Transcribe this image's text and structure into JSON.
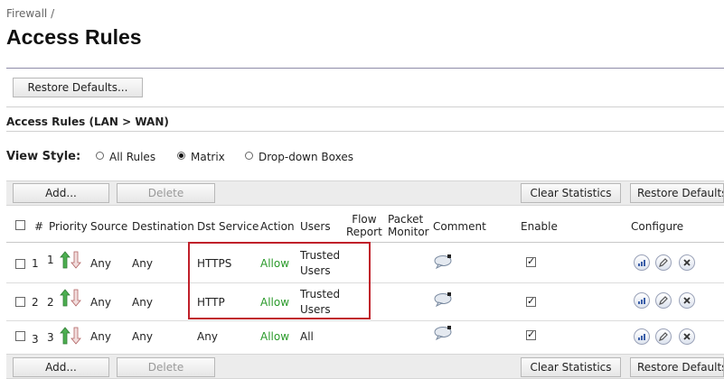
{
  "breadcrumb": "Firewall /",
  "page_title": "Access Rules",
  "restore_defaults_top": "Restore Defaults...",
  "section_title": "Access Rules (LAN > WAN)",
  "view_style": {
    "label": "View Style:",
    "options": [
      {
        "label": "All Rules",
        "selected": false
      },
      {
        "label": "Matrix",
        "selected": true
      },
      {
        "label": "Drop-down Boxes",
        "selected": false
      }
    ]
  },
  "toolbar": {
    "add": "Add...",
    "delete": "Delete",
    "clear_statistics": "Clear Statistics",
    "restore_defaults": "Restore Defaults..."
  },
  "columns": {
    "num": "#",
    "priority": "Priority",
    "source": "Source",
    "destination": "Destination",
    "dst_service": "Dst Service",
    "action": "Action",
    "users": "Users",
    "flow_report_1": "Flow",
    "flow_report_2": "Report",
    "packet_monitor_1": "Packet",
    "packet_monitor_2": "Monitor",
    "comment": "Comment",
    "enable": "Enable",
    "configure": "Configure"
  },
  "rows": [
    {
      "num": "1",
      "priority": "1",
      "source": "Any",
      "destination": "Any",
      "service": "HTTPS",
      "action": "Allow",
      "users_1": "Trusted",
      "users_2": "Users",
      "enabled": true
    },
    {
      "num": "2",
      "priority": "2",
      "source": "Any",
      "destination": "Any",
      "service": "HTTP",
      "action": "Allow",
      "users_1": "Trusted",
      "users_2": "Users",
      "enabled": true
    },
    {
      "num": "3",
      "priority": "3",
      "source": "Any",
      "destination": "Any",
      "service": "Any",
      "action": "Allow",
      "users_1": "All",
      "users_2": "",
      "enabled": true
    }
  ],
  "colors": {
    "allow": "#2a9a2a",
    "highlight": "#c0202a",
    "rule": "#8f8ca8"
  }
}
